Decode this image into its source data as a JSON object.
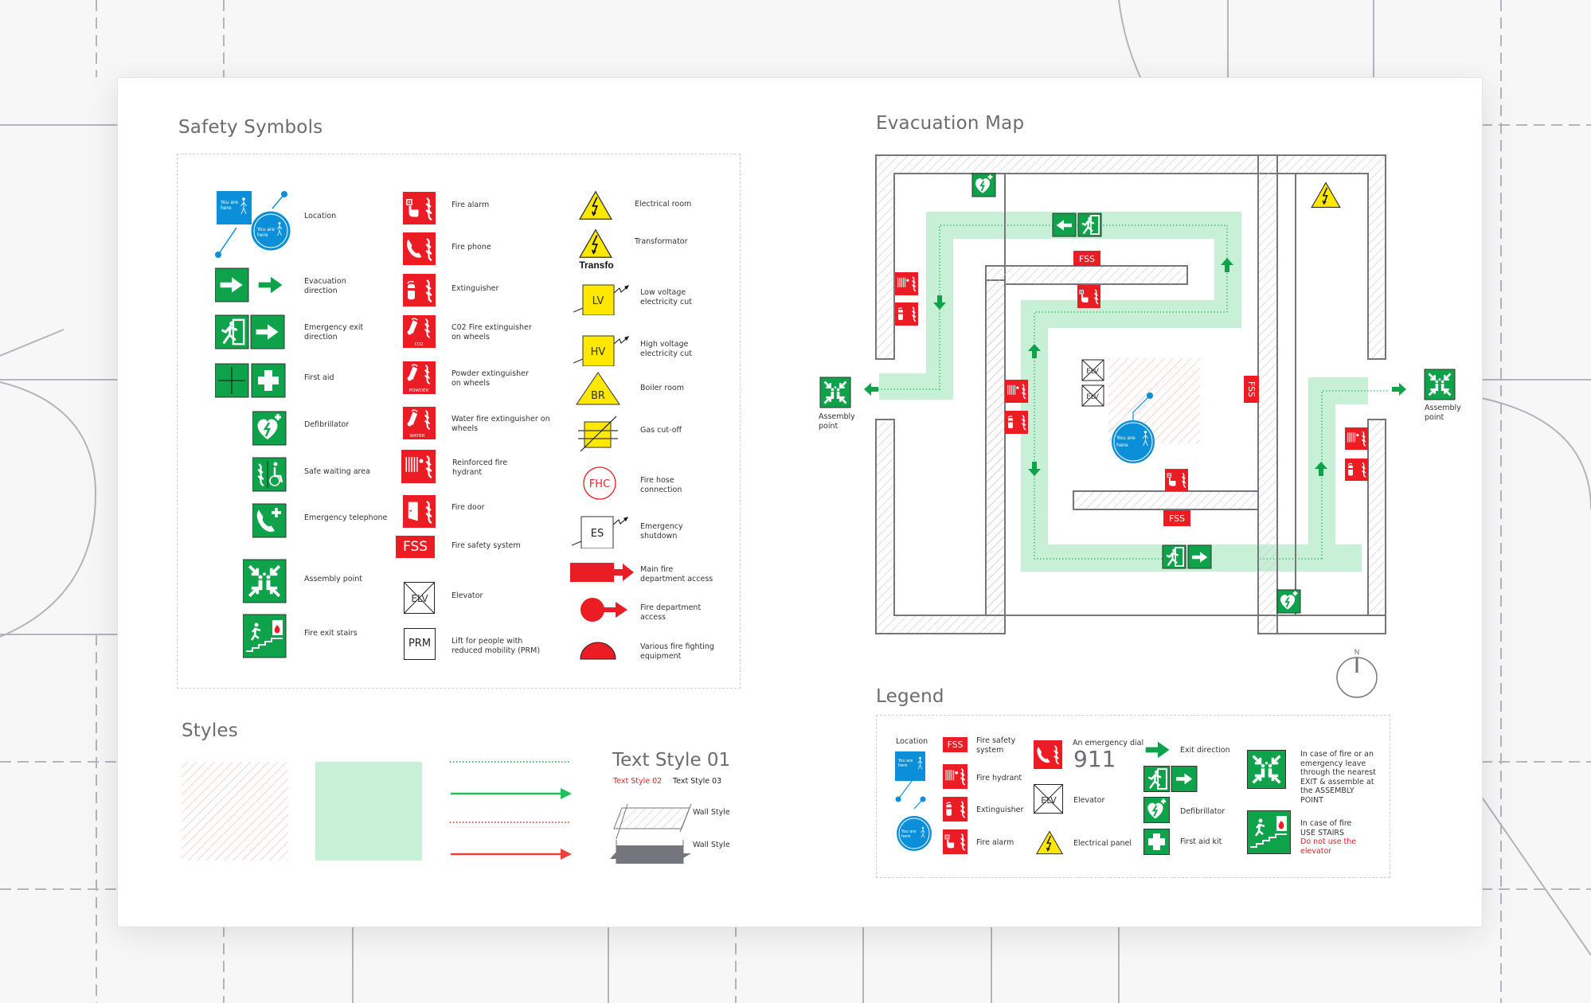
{
  "colors": {
    "green": "#0ea24a",
    "red": "#ec1c24",
    "blue": "#0a8fd8",
    "yellow": "#ffe800",
    "route": "#c8f0d6",
    "wall": "#75757d",
    "title": "#6b6b72"
  },
  "safety_symbols": {
    "title": "Safety Symbols",
    "col1": [
      {
        "icon": "location-icon",
        "label": "Location",
        "badge": "You are here"
      },
      {
        "icon": "evacuation-direction-icon",
        "label": "Evacuation direction"
      },
      {
        "icon": "emergency-exit-direction-icon",
        "label": "Emergency exit direction"
      },
      {
        "icon": "first-aid-icon",
        "label": "First aid"
      },
      {
        "icon": "defibrillator-icon",
        "label": "Defibrillator"
      },
      {
        "icon": "safe-waiting-area-icon",
        "label": "Safe waiting area"
      },
      {
        "icon": "emergency-telephone-icon",
        "label": "Emergency telephone"
      },
      {
        "icon": "assembly-point-icon",
        "label": "Assembly point"
      },
      {
        "icon": "fire-exit-stairs-icon",
        "label": "Fire exit stairs"
      }
    ],
    "col2": [
      {
        "icon": "fire-alarm-icon",
        "label": "Fire alarm"
      },
      {
        "icon": "fire-phone-icon",
        "label": "Fire phone"
      },
      {
        "icon": "extinguisher-icon",
        "label": "Extinguisher"
      },
      {
        "icon": "co2-extinguisher-icon",
        "label": "C02 Fire extinguisher on wheels",
        "tag": "CO2"
      },
      {
        "icon": "powder-extinguisher-icon",
        "label": "Powder extinguisher on wheels",
        "tag": "POWDER"
      },
      {
        "icon": "water-extinguisher-icon",
        "label": "Water fire extinguisher on wheels",
        "tag": "WATER"
      },
      {
        "icon": "fire-hydrant-icon",
        "label": "Reinforced fire hydrant"
      },
      {
        "icon": "fire-door-icon",
        "label": "Fire door"
      },
      {
        "icon": "fss-icon",
        "label": "Fire safety system",
        "tag": "FSS"
      },
      {
        "icon": "elevator-icon",
        "label": "Elevator",
        "tag": "ELV"
      },
      {
        "icon": "prm-lift-icon",
        "label": "Lift for people with reduced mobility (PRM)",
        "tag": "PRM"
      }
    ],
    "col3": [
      {
        "icon": "electrical-room-icon",
        "label": "Electrical room"
      },
      {
        "icon": "transformator-icon",
        "label": "Transformator",
        "tag": "Transfo"
      },
      {
        "icon": "low-voltage-cut-icon",
        "label": "Low voltage electricity cut",
        "tag": "LV"
      },
      {
        "icon": "high-voltage-cut-icon",
        "label": "High voltage electricity cut",
        "tag": "HV"
      },
      {
        "icon": "boiler-room-icon",
        "label": "Boiler room",
        "tag": "BR"
      },
      {
        "icon": "gas-cut-off-icon",
        "label": "Gas cut-off"
      },
      {
        "icon": "fire-hose-connection-icon",
        "label": "Fire hose connection",
        "tag": "FHC"
      },
      {
        "icon": "emergency-shutdown-icon",
        "label": "Emergency shutdown",
        "tag": "ES"
      },
      {
        "icon": "main-fire-access-icon",
        "label": "Main fire department access"
      },
      {
        "icon": "fire-access-icon",
        "label": "Fire department access"
      },
      {
        "icon": "fire-equipment-icon",
        "label": "Various fire fighting equipment"
      }
    ]
  },
  "styles": {
    "title": "Styles",
    "text_style_1": "Text Style 01",
    "text_style_2": "Text Style 02",
    "text_style_3": "Text Style 03",
    "wall_style_1": "Wall Style",
    "wall_style_2": "Wall Style"
  },
  "evacuation_map": {
    "title": "Evacuation Map",
    "assembly_left": "Assembly point",
    "assembly_right": "Assembly point",
    "you_are_here": "You are here",
    "fss": "FSS",
    "elv": "ELV",
    "compass": "N"
  },
  "legend": {
    "title": "Legend",
    "location": "Location",
    "you_are_here": "You are here",
    "fss_tag": "FSS",
    "fss": "Fire safety system",
    "hydrant": "Fire hydrant",
    "extinguisher": "Extinguisher",
    "fire_alarm": "Fire alarm",
    "emergency_dial": "An emergency dial",
    "dial_number": "911",
    "elevator_tag": "ELV",
    "elevator": "Elevator",
    "electrical_panel": "Electrical panel",
    "exit_direction": "Exit direction",
    "defibrillator": "Defibrillator",
    "first_aid": "First aid kit",
    "assembly_note": [
      "In case of fire or an",
      "emergency leave",
      "through the nearest",
      "EXIT & assemble at",
      "the ASSEMBLY",
      "POINT"
    ],
    "stairs_note": [
      "In case of fire",
      "USE STAIRS"
    ],
    "stairs_warning": [
      "Do not use the",
      "elevator"
    ]
  }
}
